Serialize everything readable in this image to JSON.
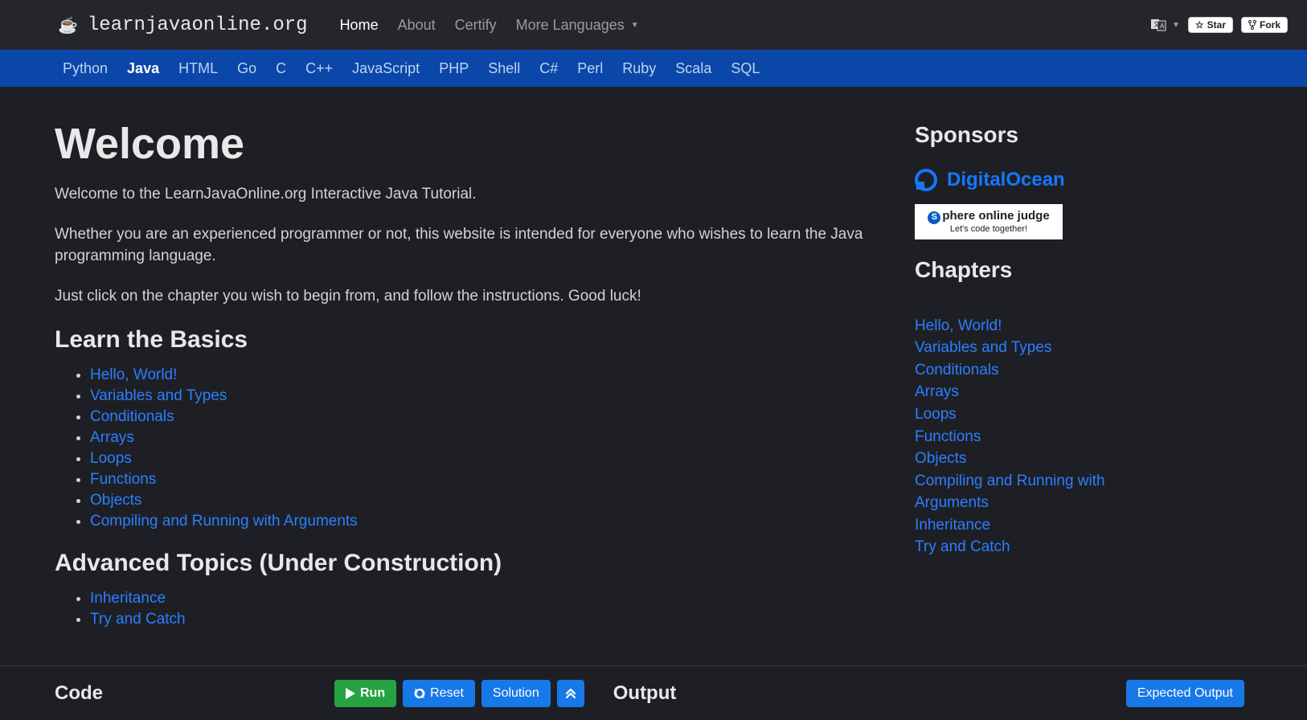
{
  "header": {
    "site_name": "learnjavaonline.org",
    "nav": {
      "home": "Home",
      "about": "About",
      "certify": "Certify",
      "more_languages": "More Languages"
    },
    "github": {
      "star": "Star",
      "fork": "Fork"
    }
  },
  "langbar": {
    "items": [
      "Python",
      "Java",
      "HTML",
      "Go",
      "C",
      "C++",
      "JavaScript",
      "PHP",
      "Shell",
      "C#",
      "Perl",
      "Ruby",
      "Scala",
      "SQL"
    ],
    "active": "Java"
  },
  "main": {
    "title": "Welcome",
    "intro1": "Welcome to the LearnJavaOnline.org Interactive Java Tutorial.",
    "intro2": "Whether you are an experienced programmer or not, this website is intended for everyone who wishes to learn the Java programming language.",
    "intro3": "Just click on the chapter you wish to begin from, and follow the instructions. Good luck!",
    "basics_heading": "Learn the Basics",
    "basics": [
      "Hello, World!",
      "Variables and Types",
      "Conditionals",
      "Arrays",
      "Loops",
      "Functions",
      "Objects",
      "Compiling and Running with Arguments"
    ],
    "advanced_heading": "Advanced Topics (Under Construction)",
    "advanced": [
      "Inheritance",
      "Try and Catch"
    ]
  },
  "sidebar": {
    "sponsors_heading": "Sponsors",
    "sponsor_do": "DigitalOcean",
    "sponsor_spoj_top": "phere online judge",
    "sponsor_spoj_bot": "Let's code together!",
    "chapters_heading": "Chapters",
    "chapters": [
      "Hello, World!",
      "Variables and Types",
      "Conditionals",
      "Arrays",
      "Loops",
      "Functions",
      "Objects",
      "Compiling and Running with Arguments",
      "Inheritance",
      "Try and Catch"
    ]
  },
  "footer": {
    "code_label": "Code",
    "run": "Run",
    "reset": "Reset",
    "solution": "Solution",
    "output_label": "Output",
    "expected_output": "Expected Output"
  }
}
